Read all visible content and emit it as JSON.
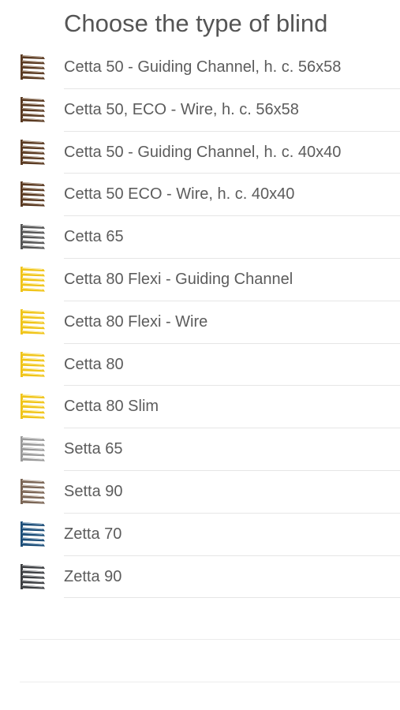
{
  "header": {
    "title": "Choose the type of blind"
  },
  "blinds": [
    {
      "label": "Cetta 50 - Guiding Channel, h. c. 56x58",
      "icon": "brown-blind-icon",
      "color": "#5a3a22",
      "accent": "#c9b7a5"
    },
    {
      "label": "Cetta 50, ECO - Wire, h. c. 56x58",
      "icon": "brown-blind-icon",
      "color": "#5a3a22",
      "accent": "#c9b7a5"
    },
    {
      "label": "Cetta 50 - Guiding Channel, h. c. 40x40",
      "icon": "brown-blind-icon",
      "color": "#5a3a22",
      "accent": "#c9b7a5"
    },
    {
      "label": "Cetta 50 ECO - Wire, h. c. 40x40",
      "icon": "brown-blind-icon",
      "color": "#5a3a22",
      "accent": "#c9b7a5"
    },
    {
      "label": "Cetta 65",
      "icon": "gray-blind-icon",
      "color": "#555555",
      "accent": "#cfcfcf"
    },
    {
      "label": "Cetta 80 Flexi - Guiding Channel",
      "icon": "yellow-blind-icon",
      "color": "#f0c419",
      "accent": "#fff4b8"
    },
    {
      "label": "Cetta 80 Flexi - Wire",
      "icon": "yellow-blind-icon",
      "color": "#f0c419",
      "accent": "#fff4b8"
    },
    {
      "label": "Cetta 80",
      "icon": "yellow-blind-icon",
      "color": "#f0c419",
      "accent": "#fff4b8"
    },
    {
      "label": "Cetta 80 Slim",
      "icon": "yellow-blind-icon",
      "color": "#f0c419",
      "accent": "#fff4b8"
    },
    {
      "label": "Setta 65",
      "icon": "silver-blind-icon",
      "color": "#9a9a9a",
      "accent": "#eeeeee"
    },
    {
      "label": "Setta 90",
      "icon": "taupe-blind-icon",
      "color": "#7a6555",
      "accent": "#d8ccc2"
    },
    {
      "label": "Zetta 70",
      "icon": "blue-blind-icon",
      "color": "#1d4e78",
      "accent": "#a9c2d8"
    },
    {
      "label": "Zetta 90",
      "icon": "dark-gray-blind-icon",
      "color": "#3d3f42",
      "accent": "#c4c6c9"
    }
  ]
}
